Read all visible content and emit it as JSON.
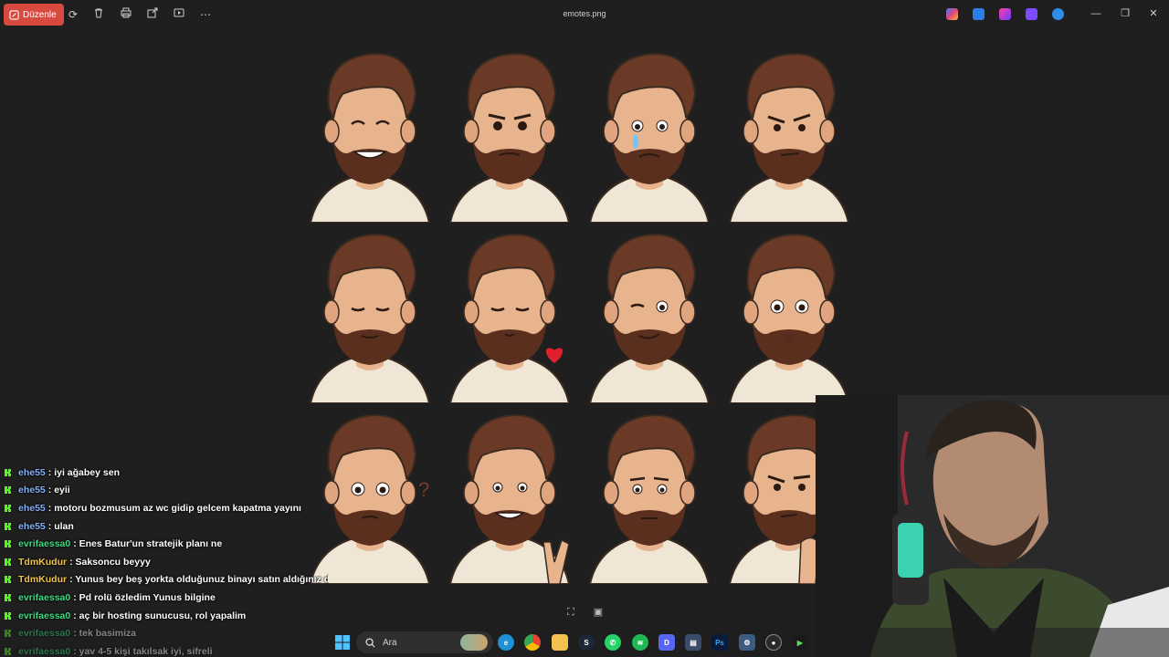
{
  "titlebar": {
    "edit_label": "Düzenle",
    "file_name": "emotes.png"
  },
  "emote_grid": {
    "rows": 3,
    "columns": 4,
    "colors": {
      "hair": "#6b3a26",
      "skin": "#e8b48e",
      "shirt": "#efe6d6",
      "background": "#1f1f1f"
    }
  },
  "chat": {
    "messages": [
      {
        "user": "ehe55",
        "user_color": "#7fb0ff",
        "text": ": iyi ağabey sen"
      },
      {
        "user": "ehe55",
        "user_color": "#7fb0ff",
        "text": ": eyii"
      },
      {
        "user": "ehe55",
        "user_color": "#7fb0ff",
        "text": ": motoru bozmusum az wc gidip gelcem kapatma yayını"
      },
      {
        "user": "ehe55",
        "user_color": "#7fb0ff",
        "text": ": ulan"
      },
      {
        "user": "evrifaessa0",
        "user_color": "#3ddc84",
        "text": ": Enes Batur'un stratejik planı ne"
      },
      {
        "user": "TdmKudur",
        "user_color": "#f5c542",
        "text": ": Saksoncu beyyy"
      },
      {
        "user": "TdmKudur",
        "user_color": "#f5c542",
        "text": ": Yunus bey beş yorkta olduğunuz binayı satın aldığınız dc"
      },
      {
        "user": "evrifaessa0",
        "user_color": "#3ddc84",
        "text": ": Pd rolü özledim Yunus bilgine"
      },
      {
        "user": "evrifaessa0",
        "user_color": "#3ddc84",
        "text": ": aç bir hosting sunucusu, rol yapalim"
      },
      {
        "user": "evrifaessa0",
        "user_color": "#3ddc84",
        "text": ": tek basimiza"
      },
      {
        "user": "evrifaessa0",
        "user_color": "#3ddc84",
        "text": ": yav 4-5 kişi takılsak iyi, sifreli"
      }
    ]
  },
  "taskbar": {
    "search_placeholder": "Ara",
    "apps": [
      "windows-start",
      "edge",
      "chrome",
      "file-explorer",
      "steam",
      "whatsapp",
      "spotify",
      "discord",
      "app-store",
      "photoshop",
      "settings",
      "obs",
      "media-player"
    ]
  },
  "colors": {
    "edit_button": "#d84a3f",
    "kick_green": "#53fc18"
  }
}
